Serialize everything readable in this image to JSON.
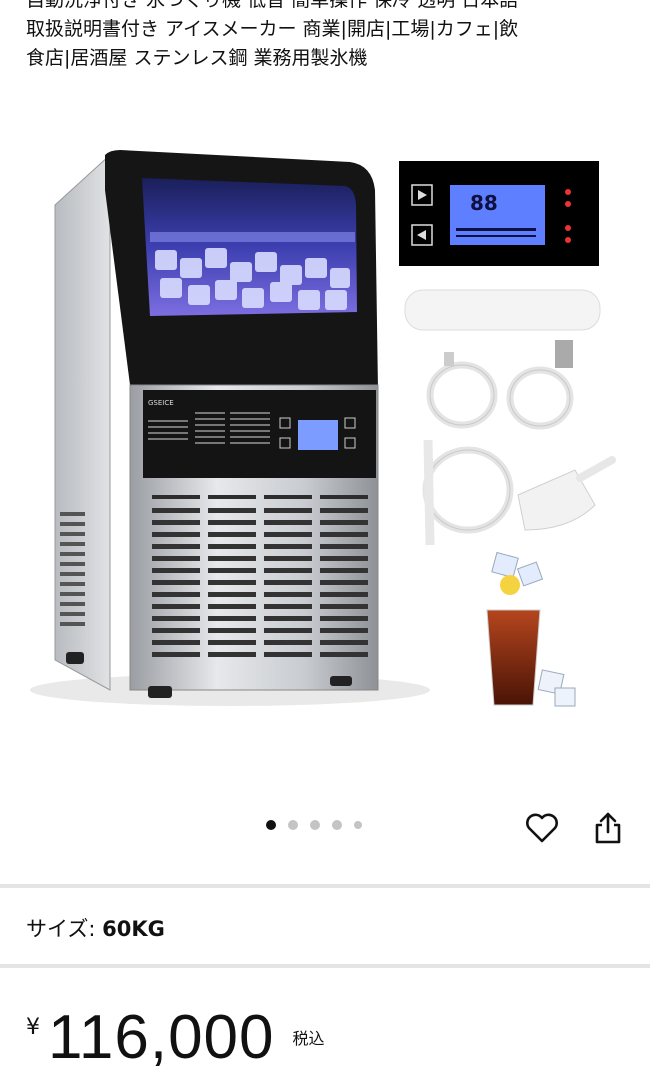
{
  "product": {
    "title_lines": [
      "自動洗浄付き 氷つくり機 低音 簡単操作 保冷 透明 日本語",
      "取扱説明書付き アイスメーカー 商業|開店|工場|カフェ|飲",
      "食店|居酒屋 ステンレス鋼 業務用製氷機"
    ],
    "brand_mark": "GSEICE",
    "lcd_digits": "88"
  },
  "gallery": {
    "page_count": 5,
    "active_index": 0
  },
  "actions": {
    "favorite_icon": "heart-icon",
    "share_icon": "share-icon"
  },
  "size": {
    "label": "サイズ:",
    "value": "60KG"
  },
  "price": {
    "currency": "¥",
    "amount": "116,000",
    "tax_note": "税込"
  }
}
